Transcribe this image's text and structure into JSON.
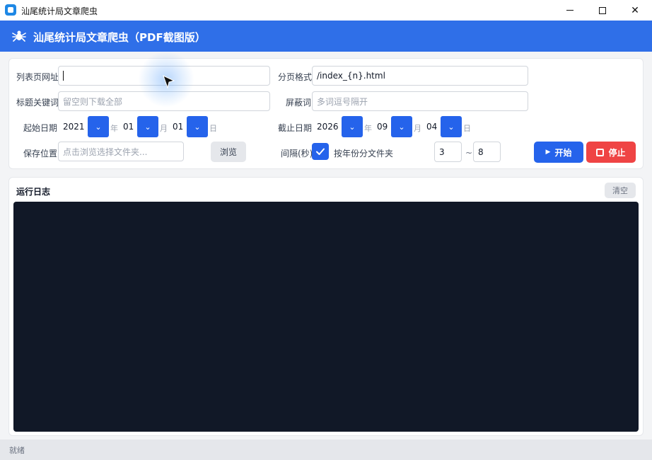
{
  "window": {
    "title": "汕尾统计局文章爬虫"
  },
  "header": {
    "title": "汕尾统计局文章爬虫（PDF截图版）",
    "icon": "spider-icon"
  },
  "form": {
    "list_url_label": "列表页网址",
    "list_url_value": "",
    "page_format_label": "分页格式",
    "page_format_value": "/index_{n}.html",
    "keyword_label": "标题关键词",
    "keyword_placeholder": "留空则下载全部",
    "block_label": "屏蔽词",
    "block_placeholder": "多词逗号隔开",
    "start_date_label": "起始日期",
    "start_year": "2021",
    "start_month": "01",
    "start_day": "01",
    "end_date_label": "截止日期",
    "end_year": "2026",
    "end_month": "09",
    "end_day": "04",
    "unit_year": "年",
    "unit_month": "月",
    "unit_day": "日",
    "save_label": "保存位置",
    "save_placeholder": "点击浏览选择文件夹...",
    "browse_label": "浏览",
    "interval_label": "间隔(秒)",
    "by_year_label": "按年份分文件夹",
    "by_year_checked": true,
    "interval_min": "3",
    "interval_sep": "~",
    "interval_max": "8",
    "start_button": "开始",
    "stop_button": "停止"
  },
  "log": {
    "title": "运行日志",
    "clear_label": "清空"
  },
  "status": {
    "text": "就绪"
  },
  "colors": {
    "accent": "#2f6fe8",
    "primary": "#2563eb",
    "danger": "#ef4444",
    "console_bg": "#111827"
  }
}
